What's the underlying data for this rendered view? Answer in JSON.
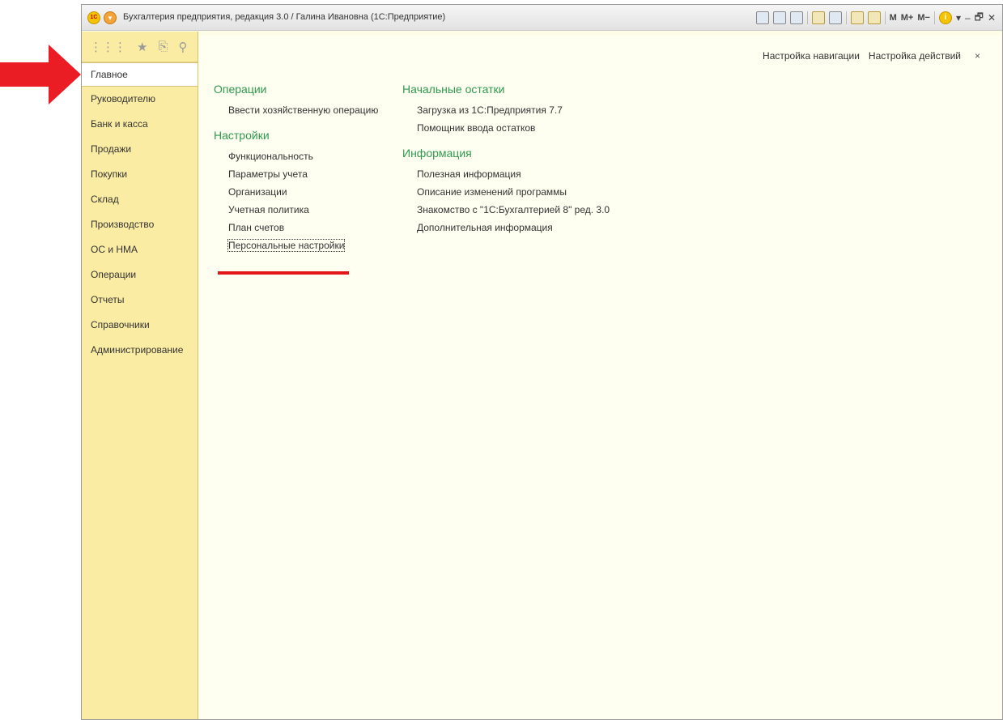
{
  "colors": {
    "annotation": "#ea1c24",
    "section_title": "#2f9a4f",
    "sidebar_bg": "#fbeca3",
    "content_bg": "#fefef1"
  },
  "window": {
    "title": "Бухгалтерия предприятия, редакция 3.0 / Галина Ивановна  (1С:Предприятие)"
  },
  "toolbar": {
    "m": "M",
    "mplus": "M+",
    "mminus": "M−",
    "info": "i",
    "minimize": "–",
    "restore": "🗗",
    "close": "✕"
  },
  "sidebar": {
    "tools": [
      {
        "icon": "apps-grid-icon"
      },
      {
        "icon": "star-icon"
      },
      {
        "icon": "history-icon"
      },
      {
        "icon": "search-icon"
      }
    ],
    "items": [
      {
        "label": "Главное",
        "active": true
      },
      {
        "label": "Руководителю"
      },
      {
        "label": "Банк и касса"
      },
      {
        "label": "Продажи"
      },
      {
        "label": "Покупки"
      },
      {
        "label": "Склад"
      },
      {
        "label": "Производство"
      },
      {
        "label": "ОС и НМА"
      },
      {
        "label": "Операции"
      },
      {
        "label": "Отчеты"
      },
      {
        "label": "Справочники"
      },
      {
        "label": "Администрирование"
      }
    ]
  },
  "content": {
    "nav_settings": "Настройка навигации",
    "action_settings": "Настройка действий",
    "close": "×",
    "left": [
      {
        "title": "Операции",
        "items": [
          "Ввести хозяйственную операцию"
        ]
      },
      {
        "title": "Настройки",
        "items": [
          "Функциональность",
          "Параметры учета",
          "Организации",
          "Учетная политика",
          "План счетов",
          "Персональные настройки"
        ]
      }
    ],
    "right": [
      {
        "title": "Начальные остатки",
        "items": [
          "Загрузка из 1С:Предприятия 7.7",
          "Помощник ввода остатков"
        ]
      },
      {
        "title": "Информация",
        "items": [
          "Полезная информация",
          "Описание изменений программы",
          "Знакомство с \"1С:Бухгалтерией 8\" ред. 3.0",
          "Дополнительная информация"
        ]
      }
    ]
  }
}
